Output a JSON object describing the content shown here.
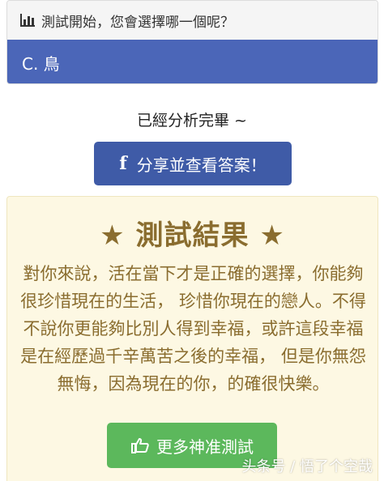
{
  "question": {
    "header_text": "測試開始，您會選擇哪一個呢？",
    "selected_option": "C. 鳥"
  },
  "analysis": {
    "status_text": "已經分析完畢 ~"
  },
  "share": {
    "icon_glyph": "f",
    "label": "分享並查看答案！"
  },
  "result": {
    "title": "★ 測試結果 ★",
    "body": "對你來說，活在當下才是正確的選擇，你能夠很珍惜現在的生活， 珍惜你現在的戀人。不得不說你更能夠比別人得到幸福，或許這段幸福是在經歷過千辛萬苦之後的幸福， 但是你無怨無悔，因為現在的你，的確很快樂。"
  },
  "more": {
    "label": "更多神准測試"
  },
  "watermark": {
    "text": "头条号 / 悟了个空哉"
  },
  "colors": {
    "option_blue": "#4b66b8",
    "facebook_blue": "#3f5ba7",
    "result_text_gold": "#8a6d2f",
    "result_bg": "#fdf8e3",
    "button_green": "#5cb85c"
  }
}
